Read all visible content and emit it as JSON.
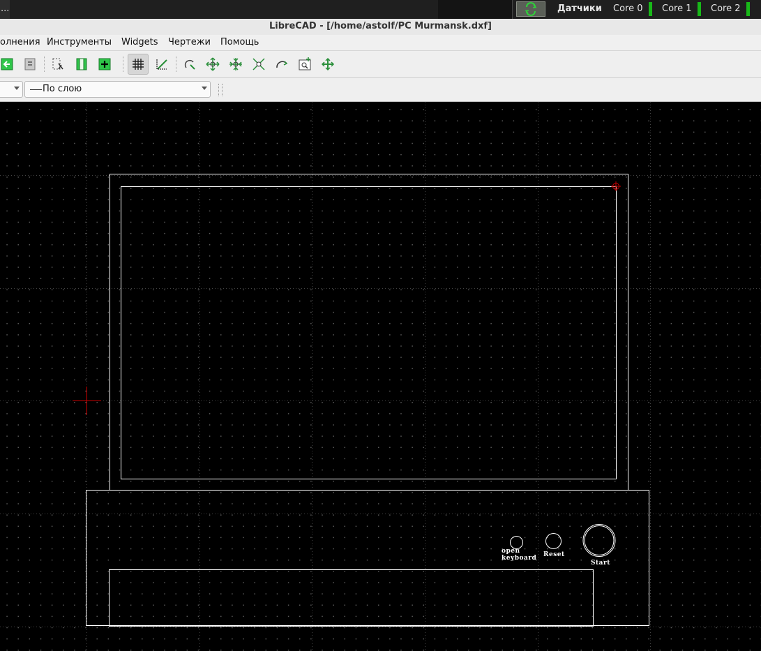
{
  "panel": {
    "taskitem_label": "...",
    "sensors_label": "Датчики",
    "cores": [
      "Core 0",
      "Core 1",
      "Core 2"
    ]
  },
  "window": {
    "title": "LibreCAD - [/home/astolf/PC Murmansk.dxf]"
  },
  "menu": [
    "олнения",
    "Инструменты",
    "Widgets",
    "Чертежи",
    "Помощь"
  ],
  "toolbar": {
    "buttons": [
      "layer-export-icon",
      "block-icon",
      "select-window-icon",
      "layer-toggle-icon",
      "layer-add-icon",
      "grid-icon",
      "snap-dimension-icon",
      "select-entity-icon",
      "zoom-in-icon",
      "zoom-out-icon",
      "zoom-auto-icon",
      "zoom-previous-icon",
      "zoom-window-icon",
      "zoom-pan-icon"
    ],
    "grid_pressed": true
  },
  "propbar": {
    "linetype_value": "По слою"
  },
  "drawing": {
    "labels": {
      "open": "open",
      "keyboard": "keyboard",
      "reset": "Reset",
      "start": "Start"
    },
    "colors": {
      "background": "#000000",
      "lines": "#ffffff",
      "grid_dots": "#5a5a5a",
      "crosshair": "#cc0000",
      "snap_marker": "#cc0000"
    }
  }
}
